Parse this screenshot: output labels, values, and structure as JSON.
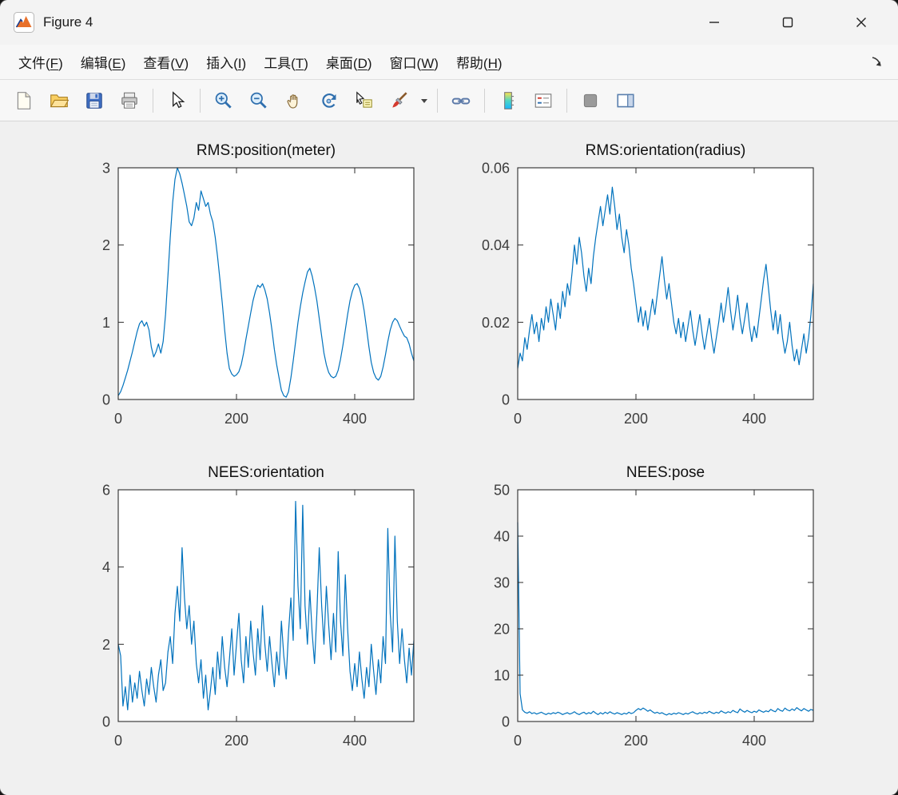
{
  "window": {
    "title": "Figure 4",
    "controls": [
      "minimize",
      "maximize",
      "close"
    ]
  },
  "menubar": {
    "items": [
      {
        "name": "menu-file",
        "label": "文件(F)",
        "key": "F"
      },
      {
        "name": "menu-edit",
        "label": "编辑(E)",
        "key": "E"
      },
      {
        "name": "menu-view",
        "label": "查看(V)",
        "key": "V"
      },
      {
        "name": "menu-insert",
        "label": "插入(I)",
        "key": "I"
      },
      {
        "name": "menu-tools",
        "label": "工具(T)",
        "key": "T"
      },
      {
        "name": "menu-desktop",
        "label": "桌面(D)",
        "key": "D"
      },
      {
        "name": "menu-window",
        "label": "窗口(W)",
        "key": "W"
      },
      {
        "name": "menu-help",
        "label": "帮助(H)",
        "key": "H"
      }
    ],
    "dock_icon": "dock-figure-arrow"
  },
  "toolbar": {
    "icons": [
      "new-figure",
      "open-file",
      "save-figure",
      "print-figure",
      "edit-plot-arrow",
      "zoom-in",
      "zoom-out",
      "pan-hand",
      "rotate-3d",
      "data-cursor",
      "brush-data",
      "brush-dropdown",
      "link-plot",
      "insert-colorbar",
      "insert-legend",
      "hide-plot-tools",
      "show-plot-tools"
    ]
  },
  "chart_style": {
    "line_color": "#0072BD",
    "axis_color": "#2b2b2b",
    "tick_label_color": "#3d3d3d",
    "title_color": "#111111",
    "figure_bg": "#f0f0f0",
    "plot_bg": "#ffffff"
  },
  "chart_data": [
    {
      "type": "line",
      "title": "RMS:position(meter)",
      "xlabel": "",
      "ylabel": "",
      "xlim": [
        0,
        500
      ],
      "ylim": [
        0,
        3
      ],
      "xticks": [
        0,
        200,
        400
      ],
      "yticks": [
        0,
        1,
        2,
        3
      ],
      "grid": false,
      "legend": null,
      "x_start": 0,
      "x_step": 4,
      "values": [
        0.05,
        0.1,
        0.18,
        0.28,
        0.38,
        0.5,
        0.62,
        0.75,
        0.88,
        0.98,
        1.02,
        0.95,
        1.0,
        0.9,
        0.68,
        0.55,
        0.62,
        0.72,
        0.6,
        0.75,
        1.1,
        1.6,
        2.1,
        2.55,
        2.85,
        3.0,
        2.92,
        2.8,
        2.65,
        2.5,
        2.3,
        2.25,
        2.35,
        2.55,
        2.45,
        2.7,
        2.6,
        2.5,
        2.55,
        2.4,
        2.3,
        2.1,
        1.85,
        1.55,
        1.25,
        0.9,
        0.6,
        0.4,
        0.33,
        0.3,
        0.32,
        0.36,
        0.45,
        0.6,
        0.78,
        0.95,
        1.12,
        1.28,
        1.4,
        1.48,
        1.45,
        1.5,
        1.42,
        1.3,
        1.12,
        0.9,
        0.65,
        0.45,
        0.28,
        0.12,
        0.05,
        0.03,
        0.1,
        0.28,
        0.5,
        0.75,
        1.0,
        1.2,
        1.38,
        1.52,
        1.65,
        1.7,
        1.6,
        1.45,
        1.28,
        1.05,
        0.82,
        0.6,
        0.45,
        0.35,
        0.3,
        0.28,
        0.3,
        0.38,
        0.52,
        0.7,
        0.9,
        1.1,
        1.28,
        1.4,
        1.48,
        1.5,
        1.44,
        1.32,
        1.15,
        0.92,
        0.68,
        0.48,
        0.35,
        0.28,
        0.25,
        0.3,
        0.42,
        0.58,
        0.75,
        0.9,
        1.0,
        1.05,
        1.02,
        0.95,
        0.88,
        0.82,
        0.8,
        0.72,
        0.6,
        0.5
      ]
    },
    {
      "type": "line",
      "title": "RMS:orientation(radius)",
      "xlabel": "",
      "ylabel": "",
      "xlim": [
        0,
        500
      ],
      "ylim": [
        0,
        0.06
      ],
      "xticks": [
        0,
        200,
        400
      ],
      "yticks": [
        0,
        0.02,
        0.04,
        0.06
      ],
      "grid": false,
      "legend": null,
      "x_start": 0,
      "x_step": 4,
      "values": [
        0.008,
        0.012,
        0.01,
        0.016,
        0.013,
        0.018,
        0.022,
        0.017,
        0.02,
        0.015,
        0.021,
        0.018,
        0.024,
        0.02,
        0.026,
        0.022,
        0.018,
        0.025,
        0.021,
        0.028,
        0.024,
        0.03,
        0.027,
        0.033,
        0.04,
        0.035,
        0.042,
        0.038,
        0.032,
        0.028,
        0.034,
        0.03,
        0.037,
        0.042,
        0.046,
        0.05,
        0.045,
        0.049,
        0.053,
        0.048,
        0.055,
        0.05,
        0.044,
        0.048,
        0.042,
        0.038,
        0.044,
        0.04,
        0.034,
        0.03,
        0.025,
        0.02,
        0.024,
        0.019,
        0.023,
        0.018,
        0.022,
        0.026,
        0.022,
        0.027,
        0.032,
        0.037,
        0.031,
        0.026,
        0.03,
        0.025,
        0.02,
        0.017,
        0.021,
        0.016,
        0.02,
        0.015,
        0.019,
        0.023,
        0.018,
        0.014,
        0.018,
        0.022,
        0.017,
        0.013,
        0.017,
        0.021,
        0.016,
        0.012,
        0.016,
        0.02,
        0.025,
        0.02,
        0.024,
        0.029,
        0.023,
        0.018,
        0.022,
        0.027,
        0.021,
        0.017,
        0.021,
        0.025,
        0.019,
        0.015,
        0.019,
        0.016,
        0.021,
        0.026,
        0.031,
        0.035,
        0.029,
        0.023,
        0.018,
        0.023,
        0.017,
        0.022,
        0.016,
        0.012,
        0.015,
        0.02,
        0.014,
        0.01,
        0.013,
        0.009,
        0.013,
        0.017,
        0.012,
        0.016,
        0.022,
        0.03
      ]
    },
    {
      "type": "line",
      "title": "NEES:orientation",
      "xlabel": "",
      "ylabel": "",
      "xlim": [
        0,
        500
      ],
      "ylim": [
        0,
        6
      ],
      "xticks": [
        0,
        200,
        400
      ],
      "yticks": [
        0,
        2,
        4,
        6
      ],
      "grid": false,
      "legend": null,
      "x_start": 0,
      "x_step": 4,
      "values": [
        2.0,
        1.7,
        0.4,
        0.9,
        0.3,
        1.2,
        0.5,
        1.0,
        0.6,
        1.3,
        0.8,
        0.4,
        1.1,
        0.7,
        1.4,
        0.9,
        0.5,
        1.2,
        1.6,
        0.8,
        1.0,
        1.8,
        2.2,
        1.5,
        2.8,
        3.5,
        2.6,
        4.5,
        3.2,
        2.4,
        3.0,
        2.0,
        2.6,
        1.5,
        1.0,
        1.6,
        0.6,
        1.2,
        0.3,
        0.8,
        1.4,
        0.7,
        1.8,
        1.1,
        2.2,
        1.4,
        0.9,
        1.6,
        2.4,
        1.2,
        2.0,
        2.8,
        1.6,
        1.0,
        2.2,
        1.4,
        2.6,
        1.8,
        1.2,
        2.4,
        1.6,
        3.0,
        2.0,
        1.3,
        2.2,
        1.5,
        0.9,
        1.8,
        1.2,
        2.6,
        1.7,
        1.1,
        2.3,
        3.2,
        2.1,
        5.7,
        3.5,
        2.4,
        5.6,
        3.0,
        2.0,
        3.4,
        2.3,
        1.5,
        2.8,
        4.5,
        3.0,
        2.0,
        3.5,
        2.5,
        1.6,
        2.8,
        1.8,
        4.4,
        2.6,
        1.7,
        3.8,
        2.4,
        1.3,
        0.8,
        1.5,
        0.9,
        1.8,
        1.1,
        0.6,
        1.4,
        0.9,
        2.0,
        1.3,
        0.7,
        1.6,
        1.0,
        2.2,
        1.5,
        5.0,
        2.8,
        1.8,
        4.8,
        2.6,
        1.5,
        2.4,
        1.6,
        1.0,
        1.9,
        1.2,
        2.1
      ]
    },
    {
      "type": "line",
      "title": "NEES:pose",
      "xlabel": "",
      "ylabel": "",
      "xlim": [
        0,
        500
      ],
      "ylim": [
        0,
        50
      ],
      "xticks": [
        0,
        200,
        400
      ],
      "yticks": [
        0,
        10,
        20,
        30,
        40,
        50
      ],
      "grid": false,
      "legend": null,
      "x_start": 0,
      "x_step": 4,
      "values": [
        43,
        6,
        2.5,
        2.0,
        1.8,
        2.1,
        1.7,
        1.9,
        1.6,
        1.8,
        2.0,
        1.7,
        1.5,
        1.8,
        1.6,
        1.9,
        1.7,
        2.0,
        1.8,
        1.5,
        1.7,
        1.9,
        1.6,
        1.8,
        2.1,
        1.7,
        1.5,
        1.8,
        2.0,
        1.6,
        1.9,
        1.7,
        2.2,
        1.8,
        1.5,
        1.9,
        1.6,
        2.0,
        1.7,
        2.1,
        1.8,
        1.6,
        1.9,
        1.7,
        1.5,
        1.8,
        1.6,
        2.0,
        1.7,
        1.9,
        2.4,
        2.8,
        2.5,
        2.9,
        2.6,
        2.2,
        2.5,
        2.1,
        1.8,
        2.0,
        1.7,
        1.9,
        1.6,
        1.4,
        1.7,
        1.5,
        1.8,
        1.6,
        1.9,
        1.7,
        1.5,
        1.8,
        1.6,
        1.9,
        2.1,
        1.8,
        1.6,
        1.9,
        1.7,
        2.0,
        1.8,
        2.2,
        1.9,
        1.7,
        2.0,
        1.8,
        2.3,
        2.0,
        1.8,
        2.1,
        1.9,
        2.4,
        2.1,
        1.9,
        2.7,
        2.3,
        2.0,
        2.4,
        2.1,
        1.9,
        2.2,
        2.0,
        2.5,
        2.2,
        2.0,
        2.3,
        2.1,
        2.6,
        2.3,
        2.1,
        2.8,
        2.4,
        2.2,
        2.9,
        2.5,
        2.3,
        2.7,
        2.4,
        3.0,
        2.6,
        2.3,
        2.8,
        2.5,
        2.2,
        2.6,
        2.4
      ]
    }
  ]
}
